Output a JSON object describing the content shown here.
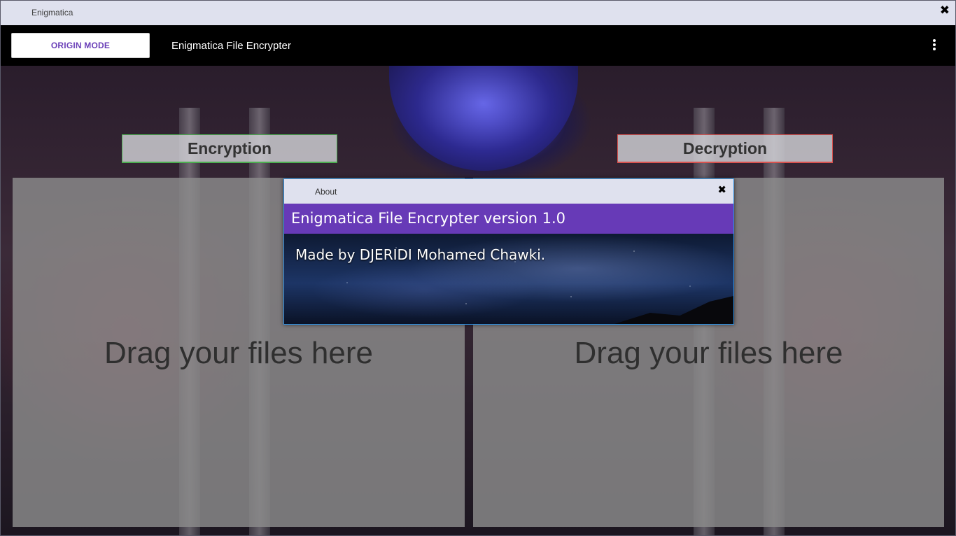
{
  "window": {
    "title": "Enigmatica",
    "close_label": "✖"
  },
  "appbar": {
    "mode_button": "ORIGIN MODE",
    "title": "Enigmatica File Encrypter",
    "menu_icon": "more-vertical-icon"
  },
  "tabs": {
    "encryption": "Encryption",
    "decryption": "Decryption",
    "encryption_accent": "#4caf50",
    "decryption_accent": "#d9534f"
  },
  "drop_zones": {
    "left_label": "Drag your files here",
    "right_label": "Drag your files here"
  },
  "about_dialog": {
    "title": "About",
    "close_label": "✖",
    "header": "Enigmatica File Encrypter version 1.0",
    "body": "Made by DJERIDI Mohamed Chawki.",
    "header_color": "#673ab7"
  }
}
